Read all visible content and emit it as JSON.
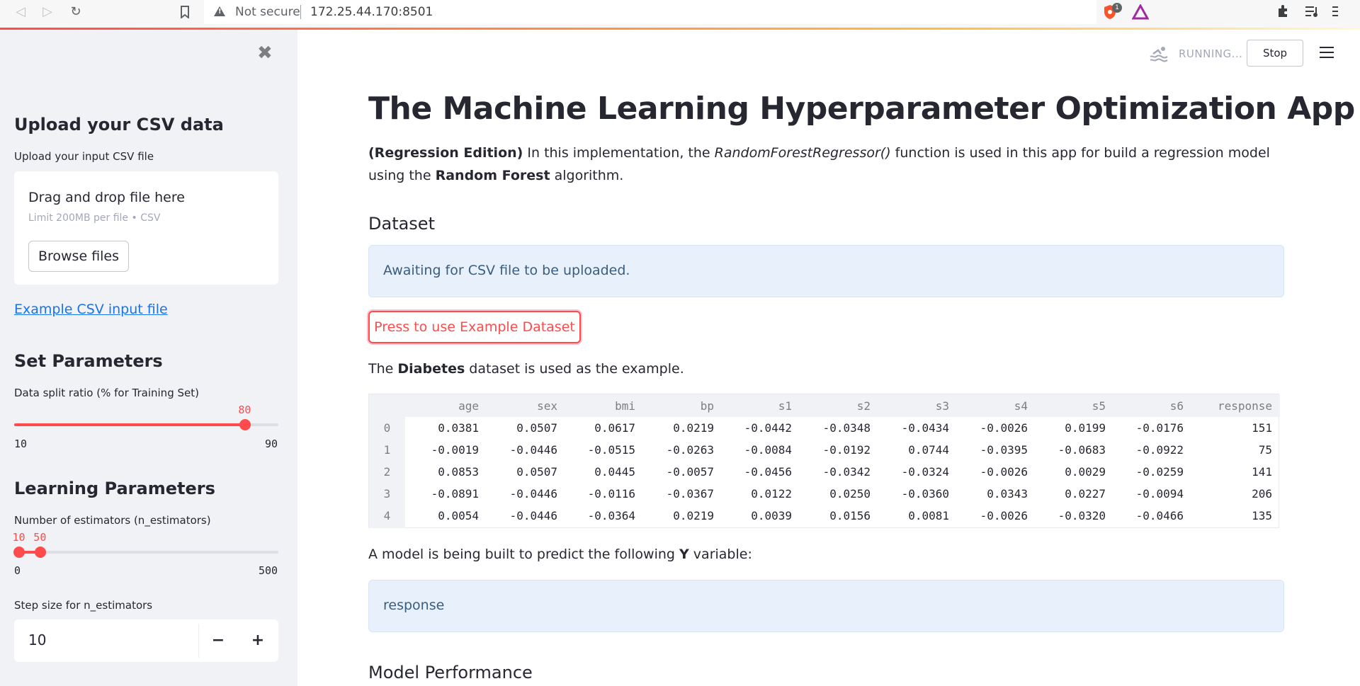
{
  "browser": {
    "security_label": "Not secure",
    "url": "172.25.44.170:8501",
    "brave_badge": "1"
  },
  "sidebar": {
    "upload_heading": "Upload your CSV data",
    "upload_label": "Upload your input CSV file",
    "dropzone_title": "Drag and drop file here",
    "dropzone_limit": "Limit 200MB per file • CSV",
    "browse_label": "Browse files",
    "example_link": "Example CSV input file",
    "params_heading": "Set Parameters",
    "split_label": "Data split ratio (% for Training Set)",
    "split_slider": {
      "min": "10",
      "max": "90",
      "value": "80",
      "fraction": 0.875
    },
    "learning_heading": "Learning Parameters",
    "estimators_label": "Number of estimators (n_estimators)",
    "estimators_slider": {
      "min": "0",
      "max": "500",
      "low": "10",
      "high": "50",
      "low_fraction": 0.02,
      "high_fraction": 0.1
    },
    "step_label": "Step size for n_estimators",
    "step_value": "10",
    "minus": "−",
    "plus": "+"
  },
  "topbar": {
    "status": "RUNNING...",
    "stop_label": "Stop"
  },
  "main": {
    "title": "The Machine Learning Hyperparameter Optimization App",
    "intro_bold": "(Regression Edition)",
    "intro_1": " In this implementation, the ",
    "intro_italic": "RandomForestRegressor()",
    "intro_2": " function is used in this app for build a regression model using the ",
    "intro_bold2": "Random Forest",
    "intro_3": " algorithm.",
    "dataset_heading": "Dataset",
    "awaiting_text": "Awaiting for CSV file to be uploaded.",
    "example_btn": "Press to use Example Dataset",
    "diabetes_pre": "The ",
    "diabetes_bold": "Diabetes",
    "diabetes_post": " dataset is used as the example.",
    "y_pre": "A model is being built to predict the following ",
    "y_bold": "Y",
    "y_post": " variable:",
    "y_value": "response",
    "perf_heading": "Model Performance"
  },
  "table": {
    "columns": [
      "age",
      "sex",
      "bmi",
      "bp",
      "s1",
      "s2",
      "s3",
      "s4",
      "s5",
      "s6",
      "response"
    ],
    "rows": [
      {
        "index": "0",
        "cells": [
          "0.0381",
          "0.0507",
          "0.0617",
          "0.0219",
          "-0.0442",
          "-0.0348",
          "-0.0434",
          "-0.0026",
          "0.0199",
          "-0.0176",
          "151"
        ]
      },
      {
        "index": "1",
        "cells": [
          "-0.0019",
          "-0.0446",
          "-0.0515",
          "-0.0263",
          "-0.0084",
          "-0.0192",
          "0.0744",
          "-0.0395",
          "-0.0683",
          "-0.0922",
          "75"
        ]
      },
      {
        "index": "2",
        "cells": [
          "0.0853",
          "0.0507",
          "0.0445",
          "-0.0057",
          "-0.0456",
          "-0.0342",
          "-0.0324",
          "-0.0026",
          "0.0029",
          "-0.0259",
          "141"
        ]
      },
      {
        "index": "3",
        "cells": [
          "-0.0891",
          "-0.0446",
          "-0.0116",
          "-0.0367",
          "0.0122",
          "0.0250",
          "-0.0360",
          "0.0343",
          "0.0227",
          "-0.0094",
          "206"
        ]
      },
      {
        "index": "4",
        "cells": [
          "0.0054",
          "-0.0446",
          "-0.0364",
          "0.0219",
          "0.0039",
          "0.0156",
          "0.0081",
          "-0.0026",
          "-0.0320",
          "-0.0466",
          "135"
        ]
      }
    ]
  },
  "colors": {
    "accent": "#ff4b4b",
    "sidebar_bg": "#f0f2f6",
    "info_bg": "#e8f1fb",
    "info_text": "#385d7f",
    "link": "#1a73e8"
  },
  "icons": {
    "back": "arrow-left-icon",
    "forward": "arrow-right-icon",
    "reload": "reload-icon",
    "bookmark": "bookmark-icon",
    "warning": "warning-icon",
    "brave": "brave-shield-icon",
    "rewards": "brave-rewards-icon",
    "extensions": "puzzle-icon",
    "playlist": "playlist-icon",
    "menu": "kebab-menu-icon",
    "close": "close-icon",
    "running": "swimmer-icon",
    "app_menu": "hamburger-icon"
  }
}
